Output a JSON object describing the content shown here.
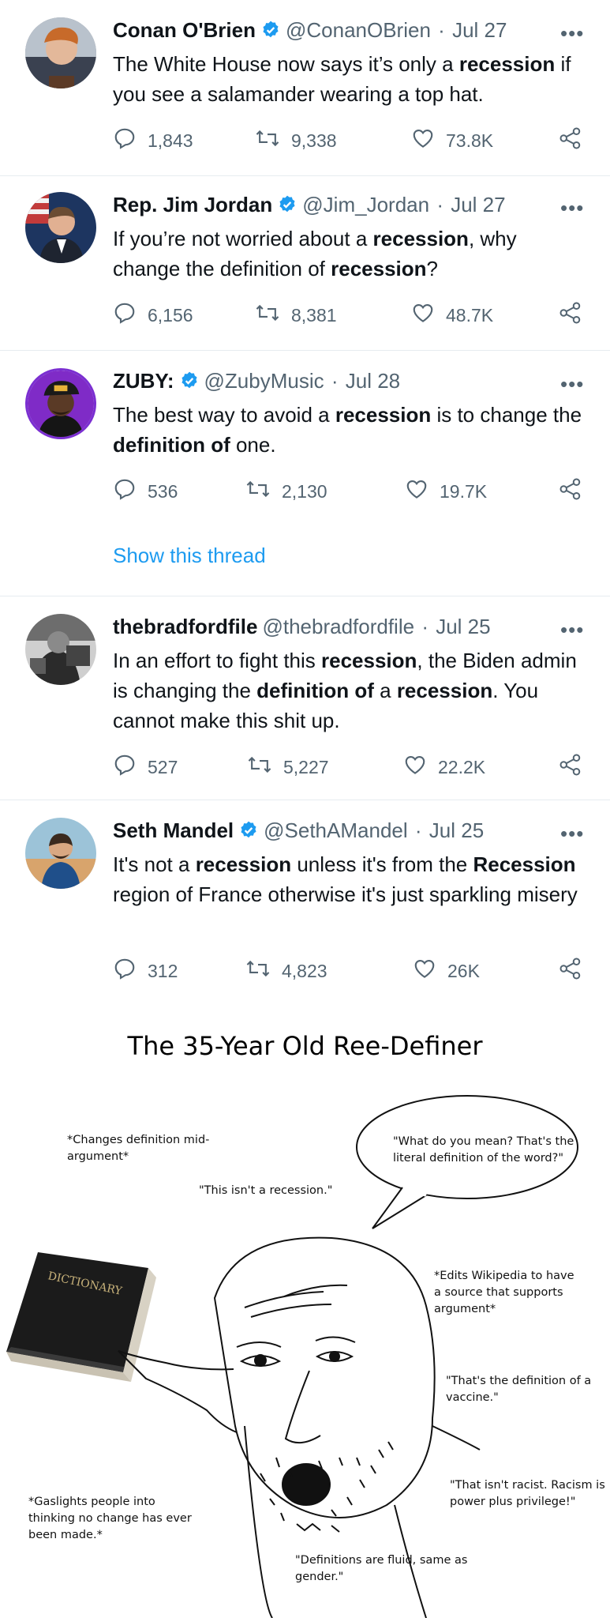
{
  "tweets": [
    {
      "name": "Conan O'Brien",
      "handle": "@ConanOBrien",
      "date": "Jul 27",
      "verified": true,
      "text_html": "The White House now says it’s only a <b>recession</b> if you see a salamander wearing a top hat.",
      "replies": "1,843",
      "retweets": "9,338",
      "likes": "73.8K"
    },
    {
      "name": "Rep. Jim Jordan",
      "handle": "@Jim_Jordan",
      "date": "Jul 27",
      "verified": true,
      "text_html": "If you’re not worried about a <b>recession</b>, why change the definition of <b>recession</b>?",
      "replies": "6,156",
      "retweets": "8,381",
      "likes": "48.7K"
    },
    {
      "name": "ZUBY:",
      "handle": "@ZubyMusic",
      "date": "Jul 28",
      "verified": true,
      "text_html": "The best way to avoid a <b>recession</b> is to change the <b>definition of</b> one.",
      "replies": "536",
      "retweets": "2,130",
      "likes": "19.7K",
      "show_thread": "Show this thread"
    },
    {
      "name": "thebradfordfile",
      "handle": "@thebradfordfile",
      "date": "Jul 25",
      "verified": false,
      "text_html": "In an effort to fight this <b>recession</b>, the Biden admin is changing the <b>definition of</b> a <b>recession</b>. You cannot make this shit up.",
      "replies": "527",
      "retweets": "5,227",
      "likes": "22.2K"
    },
    {
      "name": "Seth Mandel",
      "handle": "@SethAMandel",
      "date": "Jul 25",
      "verified": true,
      "text_html": "It's not a <b>recession</b> unless it's from the <b>Recession</b> region of France otherwise it's just sparkling misery",
      "replies": "312",
      "retweets": "4,823",
      "likes": "26K"
    }
  ],
  "separator": "·",
  "more_glyph": "•••",
  "meme": {
    "title": "The 35-Year Old Ree-Definer",
    "book_label": "DICTIONARY",
    "captions": {
      "changes": "*Changes definition mid-argument*",
      "not_recession": "\"This isn't a recession.\"",
      "what_mean": "\"What do you mean? That's the literal definition of the word?\"",
      "wikipedia": "*Edits Wikipedia to have a source that supports argument*",
      "vaccine": "\"That's the definition of a vaccine.\"",
      "racist": "\"That isn't racist. Racism is power plus privilege!\"",
      "gaslights": "*Gaslights people into thinking no change has ever been made.*",
      "fluid": "\"Definitions are fluid, same as gender.\""
    }
  }
}
